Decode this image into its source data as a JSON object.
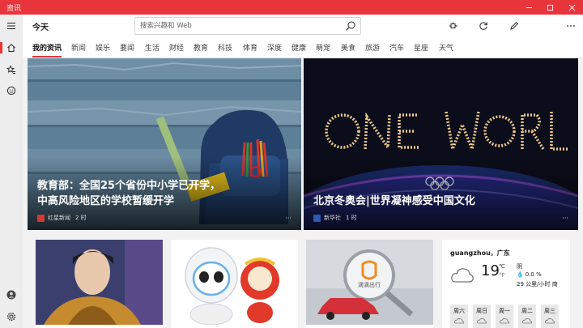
{
  "window": {
    "title": "资讯"
  },
  "header": {
    "page_title": "今天",
    "search_placeholder": "搜索兴趣和 Web"
  },
  "tabs": [
    "我的资讯",
    "新闻",
    "娱乐",
    "要闻",
    "生活",
    "财经",
    "教育",
    "科技",
    "体育",
    "深度",
    "健康",
    "萌宠",
    "美食",
    "旅游",
    "汽车",
    "星座",
    "天气"
  ],
  "active_tab": "我的资讯",
  "hero_cards": [
    {
      "headline_line1": "教育部：全国25个省份中小学已开学，",
      "headline_line2": "中高风险地区的学校暂缓开学",
      "source": "红星新闻",
      "time": "2 时"
    },
    {
      "headline_line1": "北京冬奥会|世界凝神感受中国文化",
      "source": "新华社",
      "time": "1 时"
    }
  ],
  "cards": [
    {
      "image": "costume-drama-actor-photo"
    },
    {
      "image": "winter-olympics-mascots"
    },
    {
      "image": "didi-logo-magnifier-car",
      "brand_text": "滴滴出行"
    }
  ],
  "weather": {
    "location": "guangzhou，广东",
    "temp": "19",
    "unit_c": "℃",
    "unit_f": "°F",
    "condition": "阴",
    "precip": "0.0 %",
    "wind": "29 公里/小时 南",
    "days": [
      "周六",
      "周日",
      "周一",
      "周二",
      "周三"
    ]
  },
  "colors": {
    "accent": "#e8343b"
  },
  "icons": [
    "hamburger-icon",
    "home-icon",
    "favorites-icon",
    "emoji-icon",
    "profile-icon",
    "settings-icon",
    "search-icon",
    "pin-icon",
    "refresh-icon",
    "edit-icon",
    "dark-mode-icon",
    "more-icon"
  ]
}
